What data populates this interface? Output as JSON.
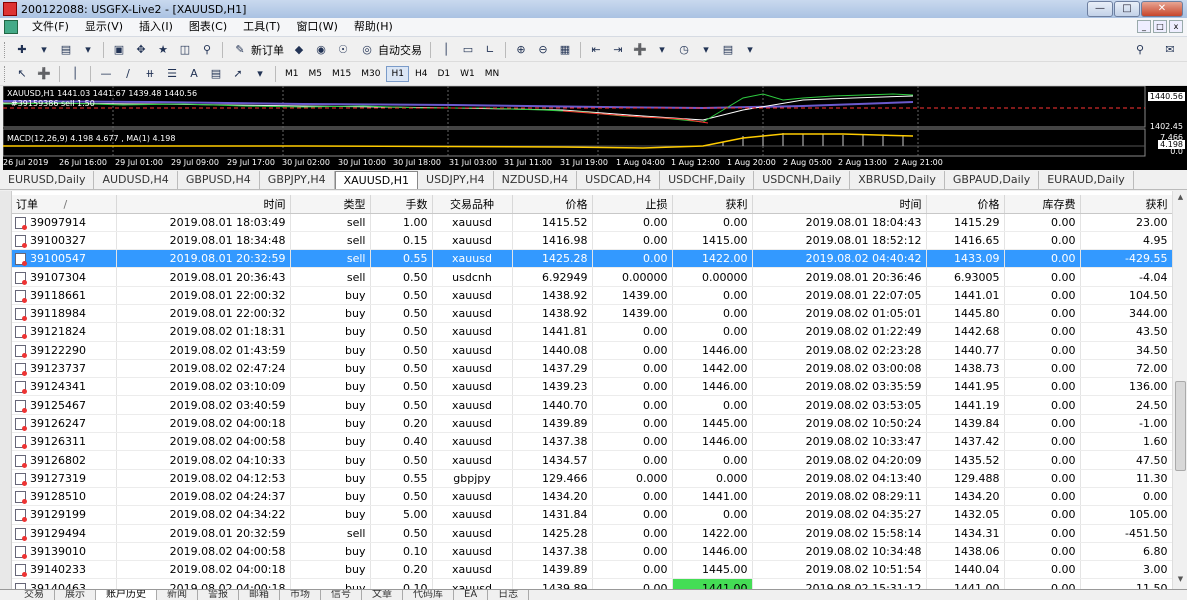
{
  "window": {
    "title": "200122088: USGFX-Live2 - [XAUUSD,H1]"
  },
  "menu": [
    "文件(F)",
    "显示(V)",
    "插入(I)",
    "图表(C)",
    "工具(T)",
    "窗口(W)",
    "帮助(H)"
  ],
  "toolbar": {
    "new_order": "新订单",
    "auto_trading": "自动交易",
    "draw_text": "A"
  },
  "timeframes": [
    "M1",
    "M5",
    "M15",
    "M30",
    "H1",
    "H4",
    "D1",
    "W1",
    "MN"
  ],
  "active_timeframe": "H1",
  "chart": {
    "header": "XAUUSD,H1  1441.03 1441.67 1439.48 1440.56",
    "trade_label": "#39159386 sell 1.50",
    "macd_label": "MACD(12,26,9) 4.198 4.677 , MA(1) 4.198",
    "price_axis": {
      "top": "1440.56",
      "mid": "1402.45",
      "macd_a": "7.466",
      "macd_b": "4.198",
      "macd_c": "0.0"
    },
    "time_labels": [
      "26 Jul 2019",
      "26 Jul 16:00",
      "29 Jul 01:00",
      "29 Jul 09:00",
      "29 Jul 17:00",
      "30 Jul 02:00",
      "30 Jul 10:00",
      "30 Jul 18:00",
      "31 Jul 03:00",
      "31 Jul 11:00",
      "31 Jul 19:00",
      "1 Aug 04:00",
      "1 Aug 12:00",
      "1 Aug 20:00",
      "2 Aug 05:00",
      "2 Aug 13:00",
      "2 Aug 21:00"
    ]
  },
  "symbol_tabs": [
    "EURUSD,Daily",
    "AUDUSD,H4",
    "GBPUSD,H4",
    "GBPJPY,H4",
    "XAUUSD,H1",
    "USDJPY,H4",
    "NZDUSD,H4",
    "USDCAD,H4",
    "USDCHF,Daily",
    "USDCNH,Daily",
    "XBRUSD,Daily",
    "GBPAUD,Daily",
    "EURAUD,Daily"
  ],
  "active_symbol_tab": "XAUUSD,H1",
  "table": {
    "columns": [
      "订单",
      "时间",
      "类型",
      "手数",
      "交易品种",
      "价格",
      "止损",
      "获利",
      "时间",
      "价格",
      "库存费",
      "获利"
    ],
    "sort_indicator": "/",
    "rows": [
      [
        "39097914",
        "2019.08.01 18:03:49",
        "sell",
        "1.00",
        "xauusd",
        "1415.52",
        "0.00",
        "0.00",
        "2019.08.01 18:04:43",
        "1415.29",
        "0.00",
        "23.00"
      ],
      [
        "39100327",
        "2019.08.01 18:34:48",
        "sell",
        "0.15",
        "xauusd",
        "1416.98",
        "0.00",
        "1415.00",
        "2019.08.01 18:52:12",
        "1416.65",
        "0.00",
        "4.95"
      ],
      [
        "39100547",
        "2019.08.01 20:32:59",
        "sell",
        "0.55",
        "xauusd",
        "1425.28",
        "0.00",
        "1422.00",
        "2019.08.02 04:40:42",
        "1433.09",
        "0.00",
        "-429.55"
      ],
      [
        "39107304",
        "2019.08.01 20:36:43",
        "sell",
        "0.50",
        "usdcnh",
        "6.92949",
        "0.00000",
        "0.00000",
        "2019.08.01 20:36:46",
        "6.93005",
        "0.00",
        "-4.04"
      ],
      [
        "39118661",
        "2019.08.01 22:00:32",
        "buy",
        "0.50",
        "xauusd",
        "1438.92",
        "1439.00",
        "0.00",
        "2019.08.01 22:07:05",
        "1441.01",
        "0.00",
        "104.50"
      ],
      [
        "39118984",
        "2019.08.01 22:00:32",
        "buy",
        "0.50",
        "xauusd",
        "1438.92",
        "1439.00",
        "0.00",
        "2019.08.02 01:05:01",
        "1445.80",
        "0.00",
        "344.00"
      ],
      [
        "39121824",
        "2019.08.02 01:18:31",
        "buy",
        "0.50",
        "xauusd",
        "1441.81",
        "0.00",
        "0.00",
        "2019.08.02 01:22:49",
        "1442.68",
        "0.00",
        "43.50"
      ],
      [
        "39122290",
        "2019.08.02 01:43:59",
        "buy",
        "0.50",
        "xauusd",
        "1440.08",
        "0.00",
        "1446.00",
        "2019.08.02 02:23:28",
        "1440.77",
        "0.00",
        "34.50"
      ],
      [
        "39123737",
        "2019.08.02 02:47:24",
        "buy",
        "0.50",
        "xauusd",
        "1437.29",
        "0.00",
        "1442.00",
        "2019.08.02 03:00:08",
        "1438.73",
        "0.00",
        "72.00"
      ],
      [
        "39124341",
        "2019.08.02 03:10:09",
        "buy",
        "0.50",
        "xauusd",
        "1439.23",
        "0.00",
        "1446.00",
        "2019.08.02 03:35:59",
        "1441.95",
        "0.00",
        "136.00"
      ],
      [
        "39125467",
        "2019.08.02 03:40:59",
        "buy",
        "0.50",
        "xauusd",
        "1440.70",
        "0.00",
        "0.00",
        "2019.08.02 03:53:05",
        "1441.19",
        "0.00",
        "24.50"
      ],
      [
        "39126247",
        "2019.08.02 04:00:18",
        "buy",
        "0.20",
        "xauusd",
        "1439.89",
        "0.00",
        "1445.00",
        "2019.08.02 10:50:24",
        "1439.84",
        "0.00",
        "-1.00"
      ],
      [
        "39126311",
        "2019.08.02 04:00:58",
        "buy",
        "0.40",
        "xauusd",
        "1437.38",
        "0.00",
        "1446.00",
        "2019.08.02 10:33:47",
        "1437.42",
        "0.00",
        "1.60"
      ],
      [
        "39126802",
        "2019.08.02 04:10:33",
        "buy",
        "0.50",
        "xauusd",
        "1434.57",
        "0.00",
        "0.00",
        "2019.08.02 04:20:09",
        "1435.52",
        "0.00",
        "47.50"
      ],
      [
        "39127319",
        "2019.08.02 04:12:53",
        "buy",
        "0.55",
        "gbpjpy",
        "129.466",
        "0.000",
        "0.000",
        "2019.08.02 04:13:40",
        "129.488",
        "0.00",
        "11.30"
      ],
      [
        "39128510",
        "2019.08.02 04:24:37",
        "buy",
        "0.50",
        "xauusd",
        "1434.20",
        "0.00",
        "1441.00",
        "2019.08.02 08:29:11",
        "1434.20",
        "0.00",
        "0.00"
      ],
      [
        "39129199",
        "2019.08.02 04:34:22",
        "buy",
        "5.00",
        "xauusd",
        "1431.84",
        "0.00",
        "0.00",
        "2019.08.02 04:35:27",
        "1432.05",
        "0.00",
        "105.00"
      ],
      [
        "39129494",
        "2019.08.01 20:32:59",
        "sell",
        "0.50",
        "xauusd",
        "1425.28",
        "0.00",
        "1422.00",
        "2019.08.02 15:58:14",
        "1434.31",
        "0.00",
        "-451.50"
      ],
      [
        "39139010",
        "2019.08.02 04:00:58",
        "buy",
        "0.10",
        "xauusd",
        "1437.38",
        "0.00",
        "1446.00",
        "2019.08.02 10:34:48",
        "1438.06",
        "0.00",
        "6.80"
      ],
      [
        "39140233",
        "2019.08.02 04:00:18",
        "buy",
        "0.20",
        "xauusd",
        "1439.89",
        "0.00",
        "1445.00",
        "2019.08.02 10:51:54",
        "1440.04",
        "0.00",
        "3.00"
      ],
      [
        "39140463",
        "2019.08.02 04:00:18",
        "buy",
        "0.10",
        "xauusd",
        "1439.89",
        "0.00",
        "1441.00",
        "2019.08.02 15:31:12",
        "1441.00",
        "0.00",
        "11.50"
      ]
    ],
    "selected_row": 2,
    "highlight_cell": {
      "row": 20,
      "col": 7
    }
  },
  "bottom_tabs": [
    "交易",
    "展示",
    "账户历史",
    "新闻",
    "警报",
    "邮箱",
    "市场",
    "信号",
    "文章",
    "代码库",
    "EA",
    "日志"
  ],
  "active_bottom_tab": "账户历史"
}
